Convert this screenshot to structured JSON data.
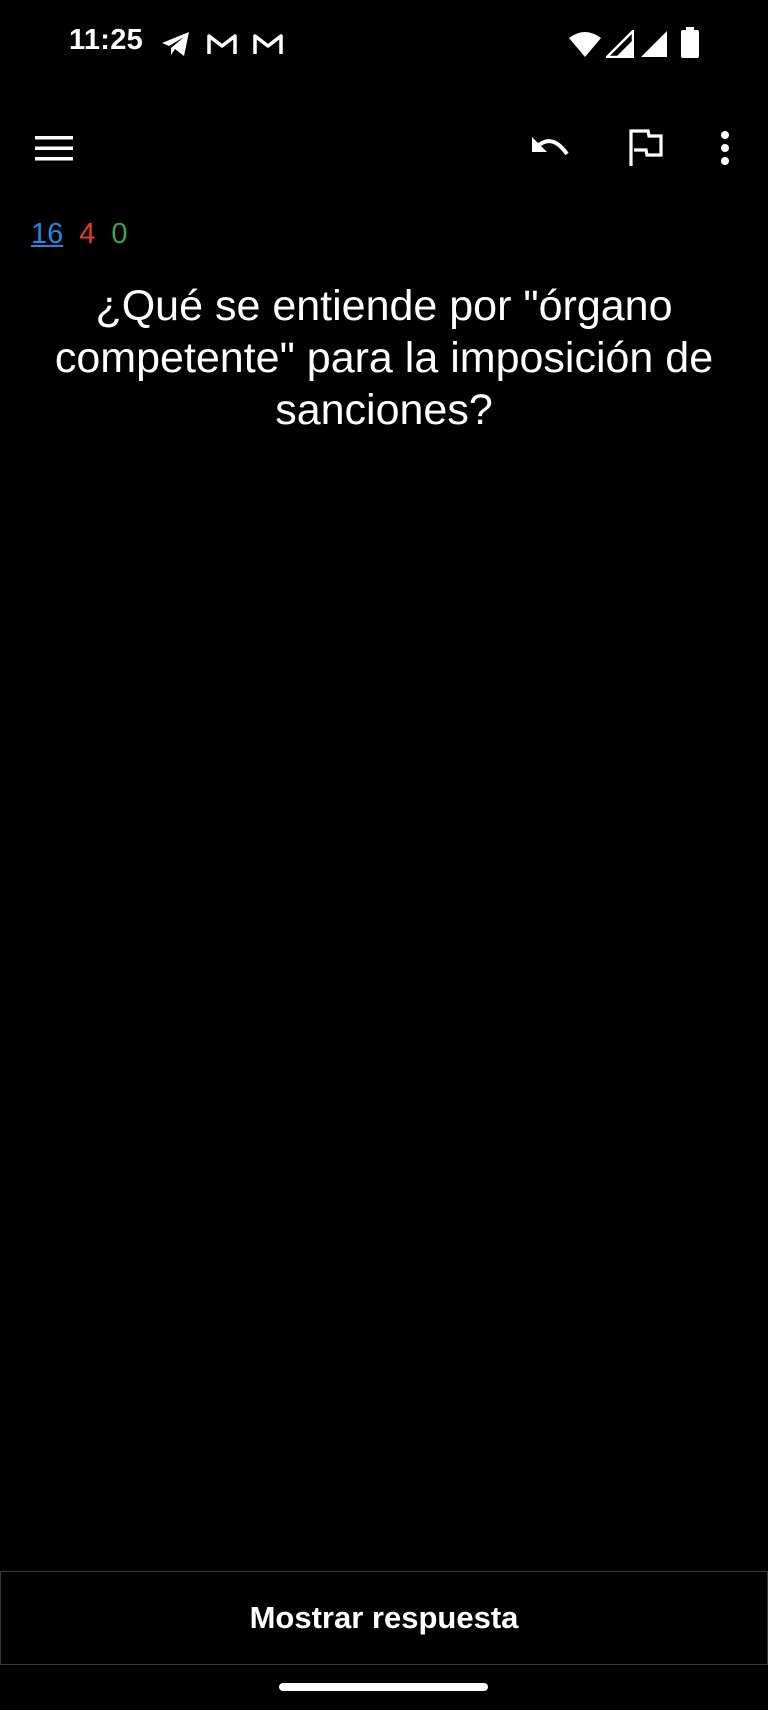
{
  "status_bar": {
    "time": "11:25",
    "icons": [
      "telegram-icon",
      "gmail-icon",
      "gmail-icon",
      "wifi-icon",
      "signal-icon",
      "signal-icon",
      "battery-icon"
    ]
  },
  "toolbar": {
    "icons": [
      "menu-icon",
      "undo-icon",
      "flag-icon",
      "more-vert-icon"
    ]
  },
  "counts": {
    "new": "16",
    "learning": "4",
    "review": "0",
    "colors": {
      "new": "#1e88e5",
      "learning": "#e53935",
      "review": "#43a047"
    }
  },
  "card": {
    "question": "¿Qué se entiende por \"órgano competente\" para la imposición de sanciones?"
  },
  "answer_button": {
    "label": "Mostrar respuesta"
  }
}
